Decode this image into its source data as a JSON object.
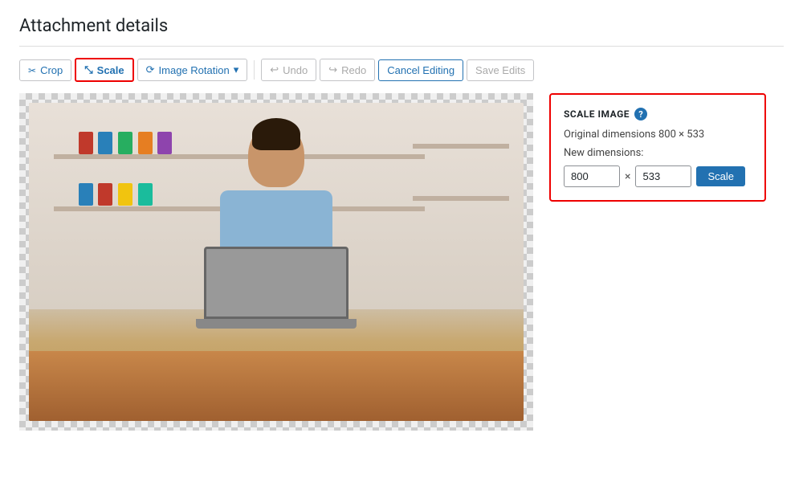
{
  "page": {
    "title": "Attachment details"
  },
  "toolbar": {
    "crop_label": "Crop",
    "scale_label": "Scale",
    "rotation_label": "Image Rotation",
    "undo_label": "Undo",
    "redo_label": "Redo",
    "cancel_label": "Cancel Editing",
    "save_label": "Save Edits"
  },
  "scale_panel": {
    "title": "SCALE IMAGE",
    "help_symbol": "?",
    "original_label": "Original dimensions 800 × 533",
    "new_dimensions_label": "New dimensions:",
    "width_value": "800",
    "height_value": "533",
    "separator": "×",
    "scale_button_label": "Scale"
  }
}
